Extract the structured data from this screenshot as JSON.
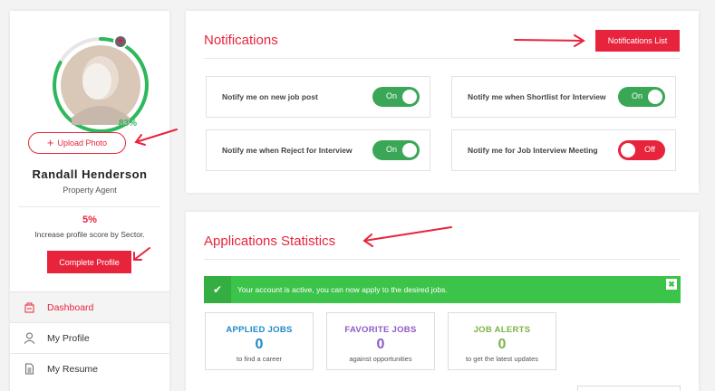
{
  "sidebar": {
    "completion_percent": "83%",
    "upload_label": "Upload Photo",
    "name": "Randall Henderson",
    "role": "Property Agent",
    "score_value": "5%",
    "score_text": "Increase profile score by Sector.",
    "complete_label": "Complete Profile",
    "nav": [
      {
        "label": "Dashboard",
        "icon": "dashboard-icon",
        "active": true
      },
      {
        "label": "My Profile",
        "icon": "user-icon",
        "active": false
      },
      {
        "label": "My Resume",
        "icon": "document-icon",
        "active": false
      }
    ]
  },
  "notifications": {
    "title": "Notifications",
    "list_button": "Notifications List",
    "items": [
      {
        "label": "Notify me on new job post",
        "state": "On"
      },
      {
        "label": "Notify me when Shortlist for Interview",
        "state": "On"
      },
      {
        "label": "Notify me when Reject for Interview",
        "state": "On"
      },
      {
        "label": "Notify me for Job Interview Meeting",
        "state": "Off"
      }
    ]
  },
  "statistics": {
    "title": "Applications Statistics",
    "alert": "Your account is active, you can now apply to the desired jobs.",
    "cards": [
      {
        "title": "APPLIED JOBS",
        "value": "0",
        "subtitle": "to find a career",
        "color": "#1e88c7"
      },
      {
        "title": "FAVORITE JOBS",
        "value": "0",
        "subtitle": "against opportunities",
        "color": "#8e5bc4"
      },
      {
        "title": "JOB ALERTS",
        "value": "0",
        "subtitle": "to get the latest updates",
        "color": "#7cb342"
      }
    ]
  },
  "colors": {
    "accent": "#e8243c",
    "success": "#3bc34a",
    "progress": "#2eb85c"
  }
}
